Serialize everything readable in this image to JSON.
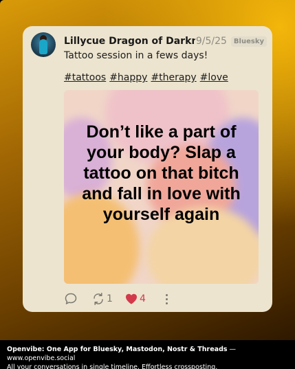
{
  "post": {
    "author": "Lillycue Dragon of Darkness",
    "date": "9/5/25",
    "source": "Bluesky",
    "text": "Tattoo session in a fews days!",
    "hashtags": [
      "#tattoos",
      "#happy",
      "#therapy",
      "#love"
    ],
    "image_text": [
      "Don’t like a part of",
      "your body? Slap a",
      "tattoo on that bitch",
      "and fall in love with",
      "yourself again"
    ],
    "reposts": "1",
    "likes": "4"
  },
  "footer": {
    "app_name": "Openvibe: One App for Bluesky, Mastodon, Nostr & Threads",
    "separator": " — ",
    "url": "www.openvibe.social",
    "tagline": "All your conversations in single timeline. Effortless crossposting."
  },
  "colors": {
    "card_bg": "#ece4cf",
    "like": "#d23a4c",
    "muted": "#7a776f",
    "gradient_top": "#f3b60a",
    "gradient_bottom": "#2e1800"
  },
  "icons": [
    "comment-icon",
    "repost-icon",
    "heart-icon",
    "more-vertical-icon"
  ]
}
